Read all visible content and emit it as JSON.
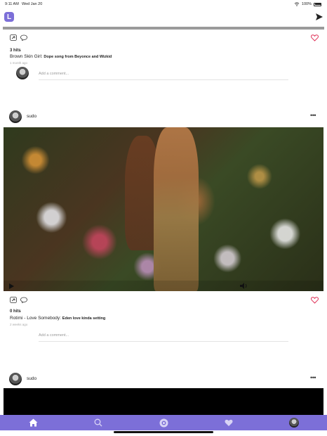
{
  "status_bar": {
    "time": "9:11 AM",
    "date": "Wed Jan 20",
    "battery": "100%"
  },
  "app": {
    "logo_letter": "L"
  },
  "posts": [
    {
      "hits": "3 hits",
      "song": "Brown Skin Girl:",
      "description": "Dope song from Beyonce and Wizkid",
      "time_ago": "1 month ago",
      "comment_placeholder": "Add a comment..."
    },
    {
      "username": "sudo",
      "more": "•••",
      "hits": "0 hits",
      "song": "Rotimi - Love Somebody:",
      "description": "Eden love kinda setting",
      "time_ago": "2 weeks ago",
      "comment_placeholder": "Add a comment..."
    },
    {
      "username": "sudo",
      "more": "•••"
    }
  ],
  "colors": {
    "accent": "#7c6fd8",
    "heart": "#e0345a"
  },
  "tabs": [
    {
      "icon": "home-icon"
    },
    {
      "icon": "search-icon"
    },
    {
      "icon": "record-icon"
    },
    {
      "icon": "heart-icon"
    },
    {
      "icon": "profile-avatar"
    }
  ]
}
